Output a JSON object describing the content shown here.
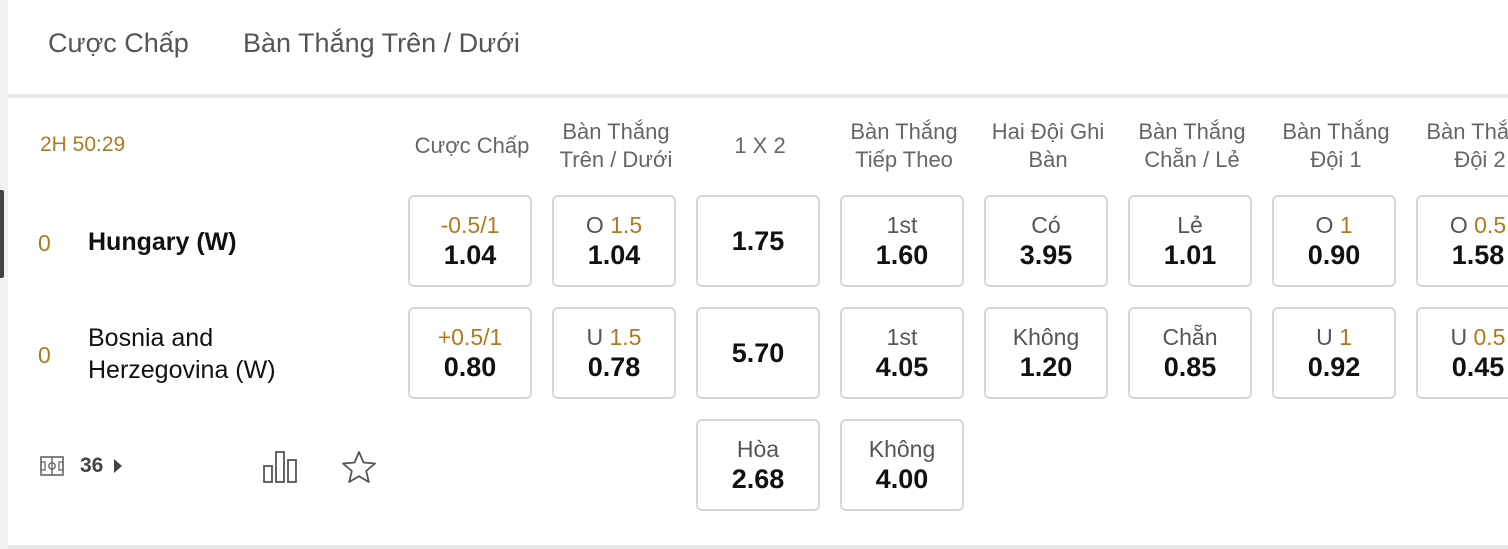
{
  "tabs": [
    "Cược Chấp",
    "Bàn Thắng Trên / Dưới"
  ],
  "match": {
    "time": "2H 50:29",
    "home": {
      "score": "0",
      "name": "Hungary (W)"
    },
    "away": {
      "score": "0",
      "name_line1": "Bosnia and",
      "name_line2": "Herzegovina (W)"
    },
    "more_markets_count": "36"
  },
  "markets": [
    {
      "head1": "Cược Chấp",
      "head2": "",
      "row1": {
        "label": "-0.5/1",
        "hl": "",
        "value": "1.04"
      },
      "row2": {
        "label": "+0.5/1",
        "hl": "",
        "value": "0.80"
      }
    },
    {
      "head1": "Bàn Thắng",
      "head2": "Trên / Dưới",
      "row1": {
        "label": "O ",
        "hl": "1.5",
        "value": "1.04"
      },
      "row2": {
        "label": "U ",
        "hl": "1.5",
        "value": "0.78"
      }
    },
    {
      "head1": "1 X 2",
      "head2": "",
      "row1": {
        "label": "",
        "hl": "",
        "value": "1.75"
      },
      "row2": {
        "label": "",
        "hl": "",
        "value": "5.70"
      },
      "row3": {
        "label": "Hòa",
        "value": "2.68"
      }
    },
    {
      "head1": "Bàn Thắng",
      "head2": "Tiếp Theo",
      "row1": {
        "label": "1st",
        "hl": "",
        "value": "1.60"
      },
      "row2": {
        "label": "1st",
        "hl": "",
        "value": "4.05"
      },
      "row3": {
        "label": "Không",
        "value": "4.00"
      }
    },
    {
      "head1": "Hai Đội Ghi",
      "head2": "Bàn",
      "row1": {
        "label": "Có",
        "hl": "",
        "value": "3.95"
      },
      "row2": {
        "label": "Không",
        "hl": "",
        "value": "1.20"
      }
    },
    {
      "head1": "Bàn Thắng",
      "head2": "Chẵn / Lẻ",
      "row1": {
        "label": "Lẻ",
        "hl": "",
        "value": "1.01"
      },
      "row2": {
        "label": "Chẵn",
        "hl": "",
        "value": "0.85"
      }
    },
    {
      "head1": "Bàn Thắng",
      "head2": "Đội 1",
      "row1": {
        "label": "O ",
        "hl": "1",
        "value": "0.90"
      },
      "row2": {
        "label": "U ",
        "hl": "1",
        "value": "0.92"
      }
    },
    {
      "head1": "Bàn Thắng",
      "head2": "Đội 2",
      "row1": {
        "label": "O ",
        "hl": "0.5",
        "value": "1.58"
      },
      "row2": {
        "label": "U ",
        "hl": "0.5",
        "value": "0.45"
      }
    }
  ],
  "colors": {
    "accent": "#b07a1f",
    "border": "#d6d6d6",
    "text": "#111111",
    "muted": "#666666"
  },
  "icons": [
    "field-icon",
    "chevron-right-icon",
    "stats-icon",
    "star-icon"
  ]
}
